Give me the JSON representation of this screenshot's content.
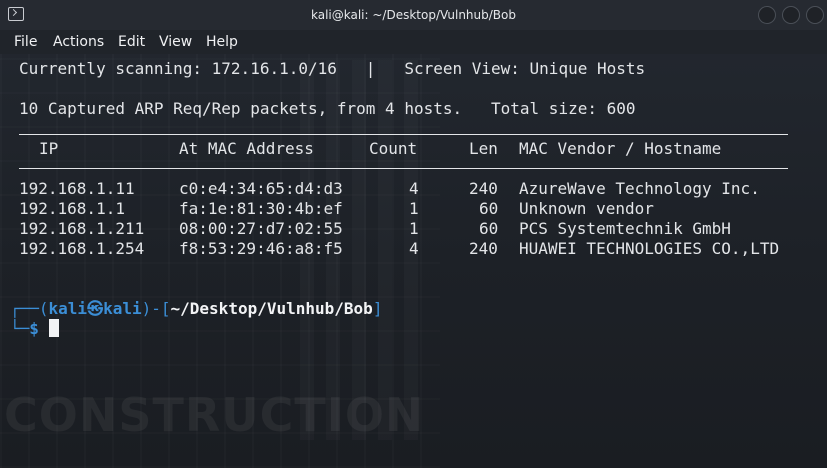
{
  "window": {
    "title": "kali@kali: ~/Desktop/Vulnhub/Bob"
  },
  "menu": [
    "File",
    "Actions",
    "Edit",
    "View",
    "Help"
  ],
  "terminal": {
    "status_line": "Currently scanning: 172.16.1.0/16   |   Screen View: Unique Hosts",
    "summary_line": "10 Captured ARP Req/Rep packets, from 4 hosts.   Total size: 600",
    "headers": {
      "ip": "IP",
      "mac": "At MAC Address",
      "count": "Count",
      "len": "Len",
      "vendor": "MAC Vendor / Hostname"
    },
    "rows": [
      {
        "ip": "192.168.1.11",
        "mac": "c0:e4:34:65:d4:d3",
        "count": "4",
        "len": "240",
        "vendor": "AzureWave Technology Inc."
      },
      {
        "ip": "192.168.1.1",
        "mac": "fa:1e:81:30:4b:ef",
        "count": "1",
        "len": "60",
        "vendor": "Unknown vendor"
      },
      {
        "ip": "192.168.1.211",
        "mac": "08:00:27:d7:02:55",
        "count": "1",
        "len": "60",
        "vendor": "PCS Systemtechnik GmbH"
      },
      {
        "ip": "192.168.1.254",
        "mac": "f8:53:29:46:a8:f5",
        "count": "4",
        "len": "240",
        "vendor": "HUAWEI TECHNOLOGIES CO.,LTD"
      }
    ],
    "prompt": {
      "corner_top": "┌──(",
      "user": "kali",
      "at": "㉿",
      "host": "kali",
      "mid": ")-[",
      "path": "~/Desktop/Vulnhub/Bob",
      "end": "]",
      "corner_bottom": "└─",
      "symbol": "$"
    }
  },
  "background_watermark": "CONSTRUCTION",
  "colors": {
    "prompt_accent": "#3b8ed6",
    "text": "#e3e5e8",
    "background": "#1f2329"
  }
}
